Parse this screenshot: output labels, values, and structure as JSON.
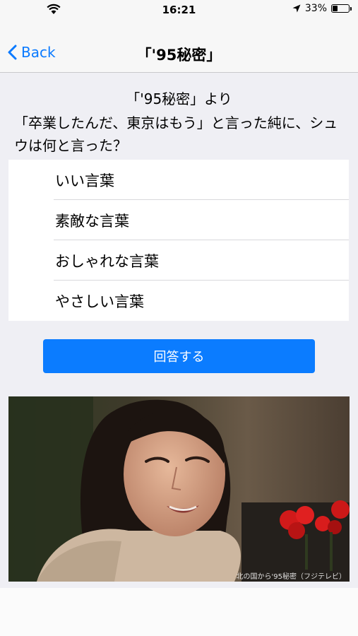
{
  "status_bar": {
    "time": "16:21",
    "battery_percent": "33%",
    "battery_level": 0.33
  },
  "nav": {
    "back_label": "Back",
    "title": "「'95秘密」"
  },
  "question": {
    "source": "「'95秘密」より",
    "text": "「卒業したんだ、東京はもう」と言った純に、シュウは何と言った？"
  },
  "answers": [
    "いい言葉",
    "素敵な言葉",
    "おしゃれな言葉",
    "やさしい言葉"
  ],
  "submit_label": "回答する",
  "photo": {
    "caption": "北の国から'95秘密（フジテレビ）"
  }
}
